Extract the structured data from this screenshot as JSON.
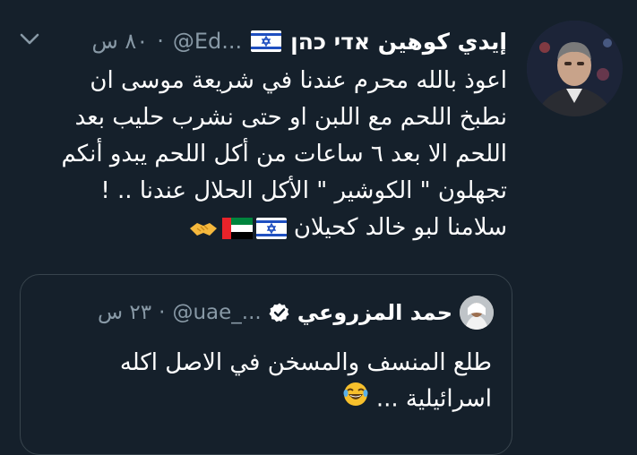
{
  "tweet": {
    "display_name": "إيدي كوهين אדי כהן",
    "handle": "@Ed...",
    "dot": "·",
    "time": "٨٠ س",
    "flag_icon": "israel-flag-icon",
    "menu_icon": "chevron-down-icon",
    "lines": [
      "اعوذ بالله محرم عندنا في شريعة موسى ان",
      "نطبخ اللحم مع اللبن او حتى نشرب حليب بعد",
      "اللحم الا بعد ٦ ساعات من أكل اللحم يبدو أنكم",
      "تجهلون \" الكوشير \" الأكل الحلال عندنا .. !",
      "سلامنا لبو خالد كحيلان"
    ],
    "emojis": [
      "israel-flag-icon",
      "uae-flag-icon",
      "handshake-icon"
    ]
  },
  "quote": {
    "display_name": "حمد المزروعي",
    "handle": "@uae_...",
    "dot": "·",
    "time": "٢٣ س",
    "verified_icon": "verified-badge-icon",
    "lines": [
      "طلع المنسف والمسخن  في الاصل اكله",
      "اسرائيلية ..."
    ],
    "emoji": "laughing-face-icon"
  },
  "colors": {
    "background": "#15202b",
    "text": "#ffffff",
    "secondary": "#8899a6",
    "border": "#38444d"
  }
}
